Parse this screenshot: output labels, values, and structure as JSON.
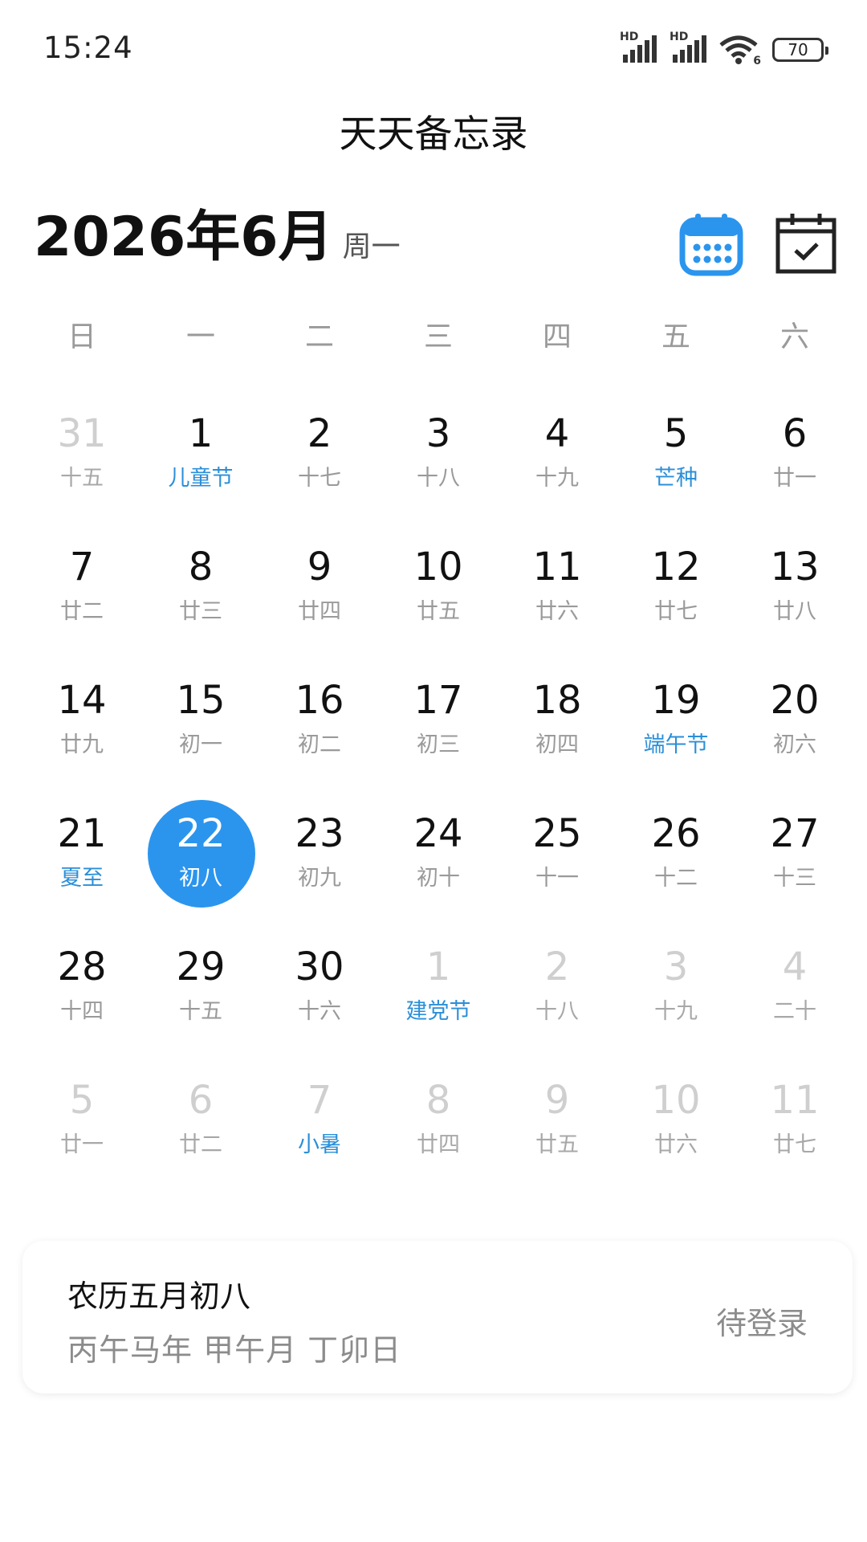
{
  "status_bar": {
    "time": "15:24",
    "signal_label_1": "HD",
    "signal_label_2": "HD",
    "wifi_icon": "wifi-icon",
    "wifi_sub": "6",
    "battery": "70"
  },
  "app": {
    "title": "天天备忘录"
  },
  "header": {
    "month_title": "2026年6月",
    "weekday": "周一",
    "accent_color": "#2b95ee",
    "calendar_icon": "calendar-grid-icon",
    "checked_icon": "calendar-check-icon"
  },
  "weekdays": [
    "日",
    "一",
    "二",
    "三",
    "四",
    "五",
    "六"
  ],
  "days": [
    {
      "num": "31",
      "sub": "十五",
      "other": true
    },
    {
      "num": "1",
      "sub": "儿童节",
      "holiday": true
    },
    {
      "num": "2",
      "sub": "十七"
    },
    {
      "num": "3",
      "sub": "十八"
    },
    {
      "num": "4",
      "sub": "十九"
    },
    {
      "num": "5",
      "sub": "芒种",
      "holiday": true
    },
    {
      "num": "6",
      "sub": "廿一"
    },
    {
      "num": "7",
      "sub": "廿二"
    },
    {
      "num": "8",
      "sub": "廿三"
    },
    {
      "num": "9",
      "sub": "廿四"
    },
    {
      "num": "10",
      "sub": "廿五"
    },
    {
      "num": "11",
      "sub": "廿六"
    },
    {
      "num": "12",
      "sub": "廿七"
    },
    {
      "num": "13",
      "sub": "廿八"
    },
    {
      "num": "14",
      "sub": "廿九"
    },
    {
      "num": "15",
      "sub": "初一"
    },
    {
      "num": "16",
      "sub": "初二"
    },
    {
      "num": "17",
      "sub": "初三"
    },
    {
      "num": "18",
      "sub": "初四"
    },
    {
      "num": "19",
      "sub": "端午节",
      "holiday": true
    },
    {
      "num": "20",
      "sub": "初六"
    },
    {
      "num": "21",
      "sub": "夏至",
      "holiday": true
    },
    {
      "num": "22",
      "sub": "初八",
      "selected": true
    },
    {
      "num": "23",
      "sub": "初九"
    },
    {
      "num": "24",
      "sub": "初十"
    },
    {
      "num": "25",
      "sub": "十一"
    },
    {
      "num": "26",
      "sub": "十二"
    },
    {
      "num": "27",
      "sub": "十三"
    },
    {
      "num": "28",
      "sub": "十四"
    },
    {
      "num": "29",
      "sub": "十五"
    },
    {
      "num": "30",
      "sub": "十六"
    },
    {
      "num": "1",
      "sub": "建党节",
      "other": true,
      "holiday": true
    },
    {
      "num": "2",
      "sub": "十八",
      "other": true
    },
    {
      "num": "3",
      "sub": "十九",
      "other": true
    },
    {
      "num": "4",
      "sub": "二十",
      "other": true
    },
    {
      "num": "5",
      "sub": "廿一",
      "other": true
    },
    {
      "num": "6",
      "sub": "廿二",
      "other": true
    },
    {
      "num": "7",
      "sub": "小暑",
      "other": true,
      "holiday": true
    },
    {
      "num": "8",
      "sub": "廿四",
      "other": true
    },
    {
      "num": "9",
      "sub": "廿五",
      "other": true
    },
    {
      "num": "10",
      "sub": "廿六",
      "other": true
    },
    {
      "num": "11",
      "sub": "廿七",
      "other": true
    }
  ],
  "info_card": {
    "lunar_date": "农历五月初八",
    "ganzhi": "丙午马年 甲午月 丁卯日",
    "login_status": "待登录"
  }
}
